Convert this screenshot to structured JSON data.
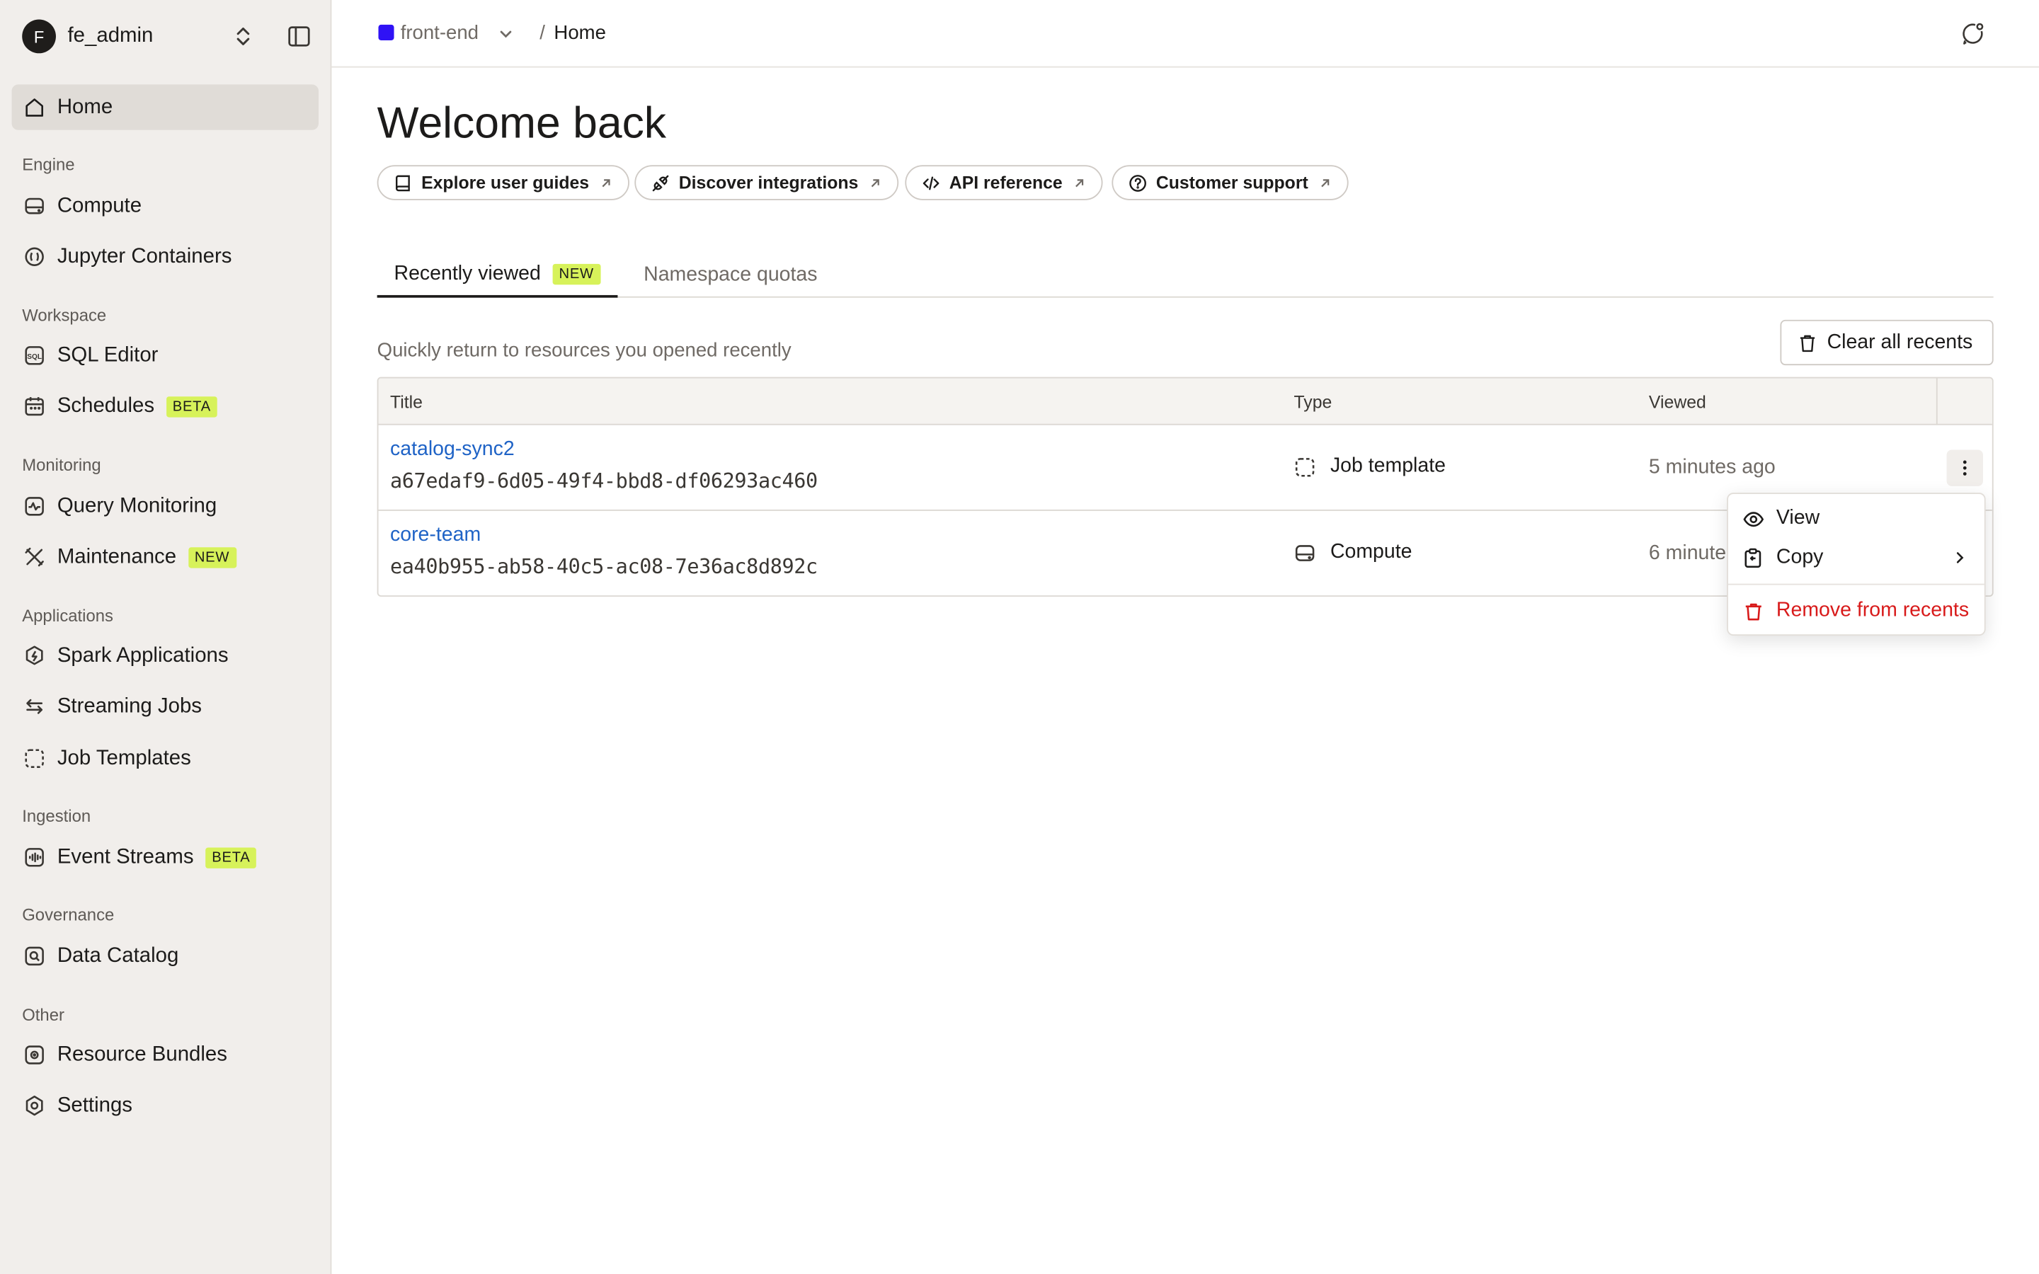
{
  "workspace": {
    "avatar_letter": "F",
    "name": "fe_admin"
  },
  "sidebar": {
    "home": "Home",
    "sections": [
      {
        "title": "Engine",
        "items": [
          {
            "label": "Compute",
            "icon": "drive-icon"
          },
          {
            "label": "Jupyter Containers",
            "icon": "jupyter-icon"
          }
        ]
      },
      {
        "title": "Workspace",
        "items": [
          {
            "label": "SQL Editor",
            "icon": "sql-icon"
          },
          {
            "label": "Schedules",
            "icon": "calendar-icon",
            "badge": "BETA"
          }
        ]
      },
      {
        "title": "Monitoring",
        "items": [
          {
            "label": "Query Monitoring",
            "icon": "pulse-icon"
          },
          {
            "label": "Maintenance",
            "icon": "tools-icon",
            "badge": "NEW"
          }
        ]
      },
      {
        "title": "Applications",
        "items": [
          {
            "label": "Spark Applications",
            "icon": "spark-icon"
          },
          {
            "label": "Streaming Jobs",
            "icon": "arrows-icon"
          },
          {
            "label": "Job Templates",
            "icon": "dashed-square-icon"
          }
        ]
      },
      {
        "title": "Ingestion",
        "items": [
          {
            "label": "Event Streams",
            "icon": "waveform-icon",
            "badge": "BETA"
          }
        ]
      },
      {
        "title": "Governance",
        "items": [
          {
            "label": "Data Catalog",
            "icon": "catalog-icon"
          }
        ]
      },
      {
        "title": "Other",
        "items": [
          {
            "label": "Resource Bundles",
            "icon": "bundle-icon"
          },
          {
            "label": "Settings",
            "icon": "gear-icon"
          }
        ]
      }
    ]
  },
  "topbar": {
    "namespace": "front-end",
    "namespace_color": "#2f12f5",
    "separator": "/",
    "crumb": "Home"
  },
  "main": {
    "heading": "Welcome back",
    "quick_links": [
      "Explore user guides",
      "Discover integrations",
      "API reference",
      "Customer support"
    ],
    "tabs": [
      {
        "label": "Recently viewed",
        "badge": "NEW"
      },
      {
        "label": "Namespace quotas"
      }
    ],
    "subtitle": "Quickly return to resources you opened recently",
    "clear_button": "Clear all recents",
    "table": {
      "columns": [
        "Title",
        "Type",
        "Viewed"
      ],
      "rows": [
        {
          "title": "catalog-sync2",
          "id": "a67edaf9-6d05-49f4-bbd8-df06293ac460",
          "type": "Job template",
          "viewed": "5 minutes ago"
        },
        {
          "title": "core-team",
          "id": "ea40b955-ab58-40c5-ac08-7e36ac8d892c",
          "type": "Compute",
          "viewed": "6 minute"
        }
      ]
    },
    "context_menu": {
      "view": "View",
      "copy": "Copy",
      "remove": "Remove from recents"
    }
  },
  "colors": {
    "link": "#1f63c6",
    "badge": "#d7f25a",
    "danger": "#d81a1a",
    "sidebar_bg": "#f1eeeb"
  }
}
